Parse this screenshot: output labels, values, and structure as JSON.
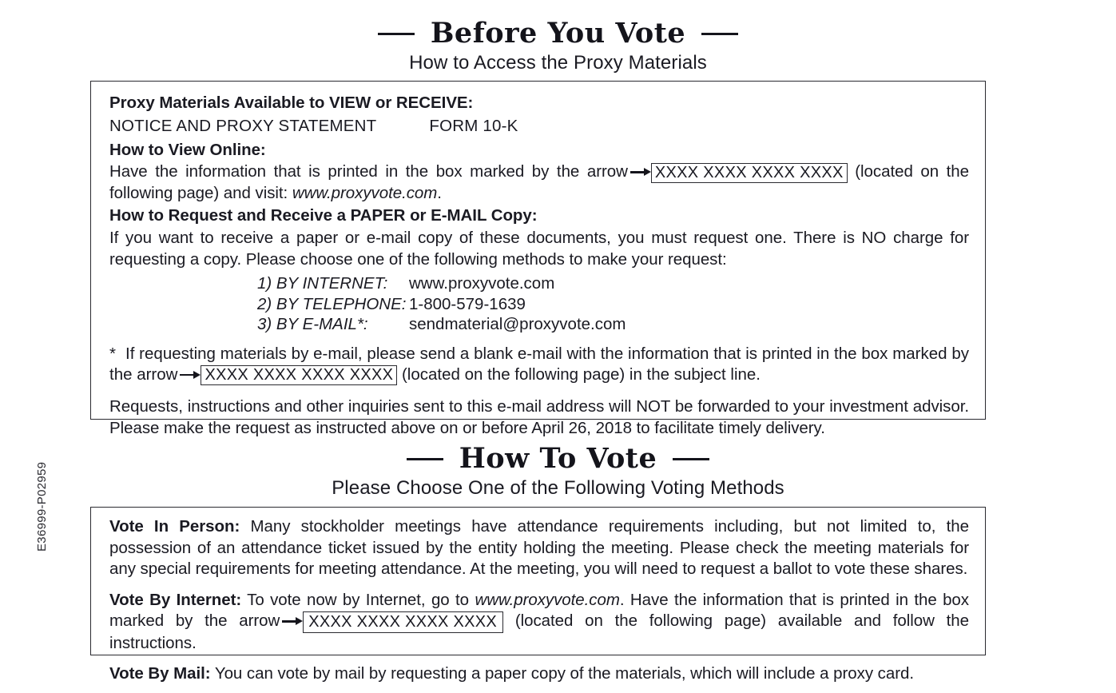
{
  "side_code": "E36999-P02959",
  "section_one": {
    "title": "Before You Vote",
    "subtitle": "How to Access the Proxy Materials",
    "available_heading": "Proxy Materials Available to VIEW or RECEIVE:",
    "available_items": [
      "NOTICE AND PROXY STATEMENT",
      "FORM 10-K"
    ],
    "view_online_heading": "How to View Online:",
    "view_online_text_before": "Have the information that is printed in the box marked by the arrow",
    "control_number": "XXXX XXXX XXXX XXXX",
    "view_online_text_after": "(located on the following page) and visit:",
    "view_online_url": "www.proxyvote.com",
    "view_online_period": ".",
    "request_heading": "How to Request and Receive a PAPER or E-MAIL Copy:",
    "request_text": "If you want to receive a paper or e-mail copy of these documents, you must request one.  There is NO charge for requesting a copy.  Please choose one of the following methods to make your request:",
    "methods": [
      {
        "label": "1) BY INTERNET:",
        "value": "www.proxyvote.com"
      },
      {
        "label": "2) BY TELEPHONE:",
        "value": "1-800-579-1639"
      },
      {
        "label": "3) BY E-MAIL*:",
        "value": "sendmaterial@proxyvote.com"
      }
    ],
    "footnote_marker": "*",
    "footnote_before": "If requesting materials by e-mail, please send a blank e-mail with the information that is printed in the box marked by the arrow",
    "footnote_after": "(located on the following page) in the subject line.",
    "closing_text": "Requests, instructions and other inquiries sent to this e-mail address will NOT be forwarded to your investment advisor.  Please make the request as instructed above on or before April 26, 2018 to facilitate timely delivery."
  },
  "section_two": {
    "title": "How To Vote",
    "subtitle": "Please Choose One of the Following Voting Methods",
    "vote_in_person_label": "Vote In Person:",
    "vote_in_person_text": "Many stockholder meetings have attendance requirements including, but not limited to, the possession of an attendance ticket issued by the entity holding the meeting. Please check the meeting materials for any special requirements for meeting attendance.  At the meeting, you will need to request a ballot to vote these shares.",
    "vote_by_internet_label": "Vote By Internet:",
    "vote_by_internet_before": "To vote now by Internet, go to",
    "vote_by_internet_url": "www.proxyvote.com",
    "vote_by_internet_middle": ".  Have the information that is printed in the box marked by the arrow",
    "control_number": "XXXX XXXX XXXX XXXX",
    "vote_by_internet_after": "(located on the following page) available and follow the instructions.",
    "vote_by_mail_label": "Vote By Mail:",
    "vote_by_mail_text": "You can vote by mail by requesting a paper copy of the materials, which will include a proxy card."
  }
}
